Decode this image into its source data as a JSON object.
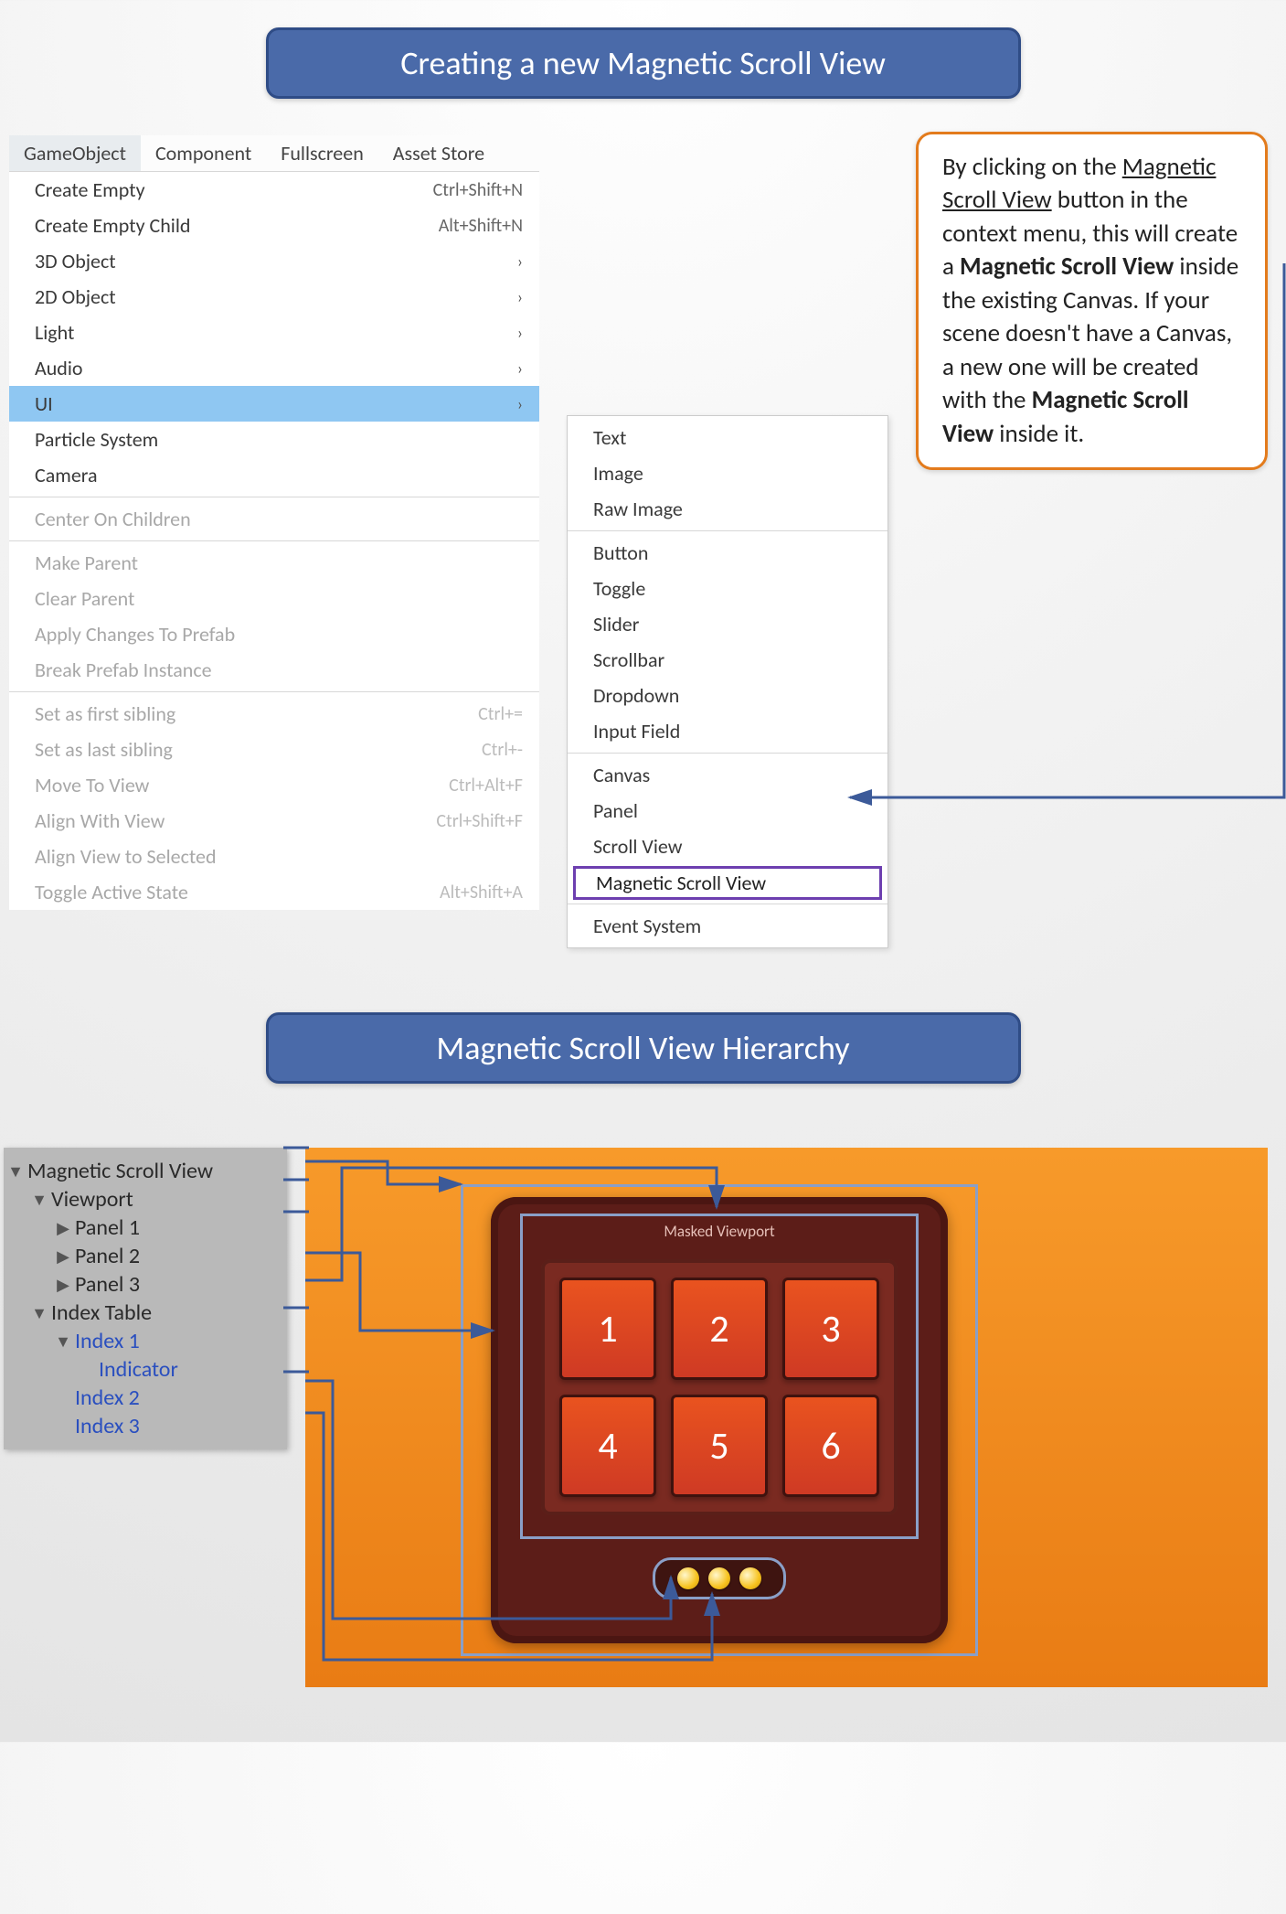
{
  "banners": {
    "creating": "Creating a new Magnetic Scroll View",
    "hierarchy": "Magnetic Scroll View Hierarchy"
  },
  "callout": {
    "pre": "By clicking on the ",
    "underline": "Magnetic Scroll View",
    "mid1": " button in the context menu, this will create a ",
    "bold1": "Magnetic Scroll View",
    "mid2": " inside the existing Canvas. If your scene doesn't have a Canvas, a new one will be created with the ",
    "bold2": "Magnetic Scroll View",
    "post": " inside it."
  },
  "menubar": {
    "items": [
      "GameObject",
      "Component",
      "Fullscreen",
      "Asset Store"
    ],
    "active_index": 0
  },
  "menu": {
    "groups": [
      [
        {
          "label": "Create Empty",
          "shortcut": "Ctrl+Shift+N"
        },
        {
          "label": "Create Empty Child",
          "shortcut": "Alt+Shift+N"
        },
        {
          "label": "3D Object",
          "submenu": true
        },
        {
          "label": "2D Object",
          "submenu": true
        },
        {
          "label": "Light",
          "submenu": true
        },
        {
          "label": "Audio",
          "submenu": true
        },
        {
          "label": "UI",
          "submenu": true,
          "highlight": true
        },
        {
          "label": "Particle System"
        },
        {
          "label": "Camera"
        }
      ],
      [
        {
          "label": "Center On Children",
          "disabled": true
        }
      ],
      [
        {
          "label": "Make Parent",
          "disabled": true
        },
        {
          "label": "Clear Parent",
          "disabled": true
        },
        {
          "label": "Apply Changes To Prefab",
          "disabled": true
        },
        {
          "label": "Break Prefab Instance",
          "disabled": true
        }
      ],
      [
        {
          "label": "Set as first sibling",
          "shortcut": "Ctrl+=",
          "disabled": true
        },
        {
          "label": "Set as last sibling",
          "shortcut": "Ctrl+-",
          "disabled": true
        },
        {
          "label": "Move To View",
          "shortcut": "Ctrl+Alt+F",
          "disabled": true
        },
        {
          "label": "Align With View",
          "shortcut": "Ctrl+Shift+F",
          "disabled": true
        },
        {
          "label": "Align View to Selected",
          "disabled": true
        },
        {
          "label": "Toggle Active State",
          "shortcut": "Alt+Shift+A",
          "disabled": true
        }
      ]
    ]
  },
  "submenu": {
    "groups": [
      [
        "Text",
        "Image",
        "Raw Image"
      ],
      [
        "Button",
        "Toggle",
        "Slider",
        "Scrollbar",
        "Dropdown",
        "Input Field"
      ],
      [
        "Canvas",
        "Panel",
        "Scroll View"
      ],
      [
        "Event System"
      ]
    ],
    "featured": "Magnetic Scroll View"
  },
  "hierarchy": {
    "items": [
      {
        "label": "Magnetic Scroll View",
        "depth": 0,
        "tri": "open"
      },
      {
        "label": "Viewport",
        "depth": 1,
        "tri": "open"
      },
      {
        "label": "Panel 1",
        "depth": 2,
        "tri": "closed"
      },
      {
        "label": "Panel 2",
        "depth": 2,
        "tri": "closed"
      },
      {
        "label": "Panel 3",
        "depth": 2,
        "tri": "closed"
      },
      {
        "label": "Index Table",
        "depth": 1,
        "tri": "open"
      },
      {
        "label": "Index 1",
        "depth": 2,
        "tri": "open",
        "blue": true
      },
      {
        "label": "Indicator",
        "depth": 3,
        "tri": "none",
        "blue": true
      },
      {
        "label": "Index 2",
        "depth": 2,
        "tri": "none",
        "blue": true
      },
      {
        "label": "Index 3",
        "depth": 2,
        "tri": "none",
        "blue": true
      }
    ]
  },
  "preview": {
    "viewport_label": "Masked Viewport",
    "tiles": [
      "1",
      "2",
      "3",
      "4",
      "5",
      "6"
    ]
  }
}
